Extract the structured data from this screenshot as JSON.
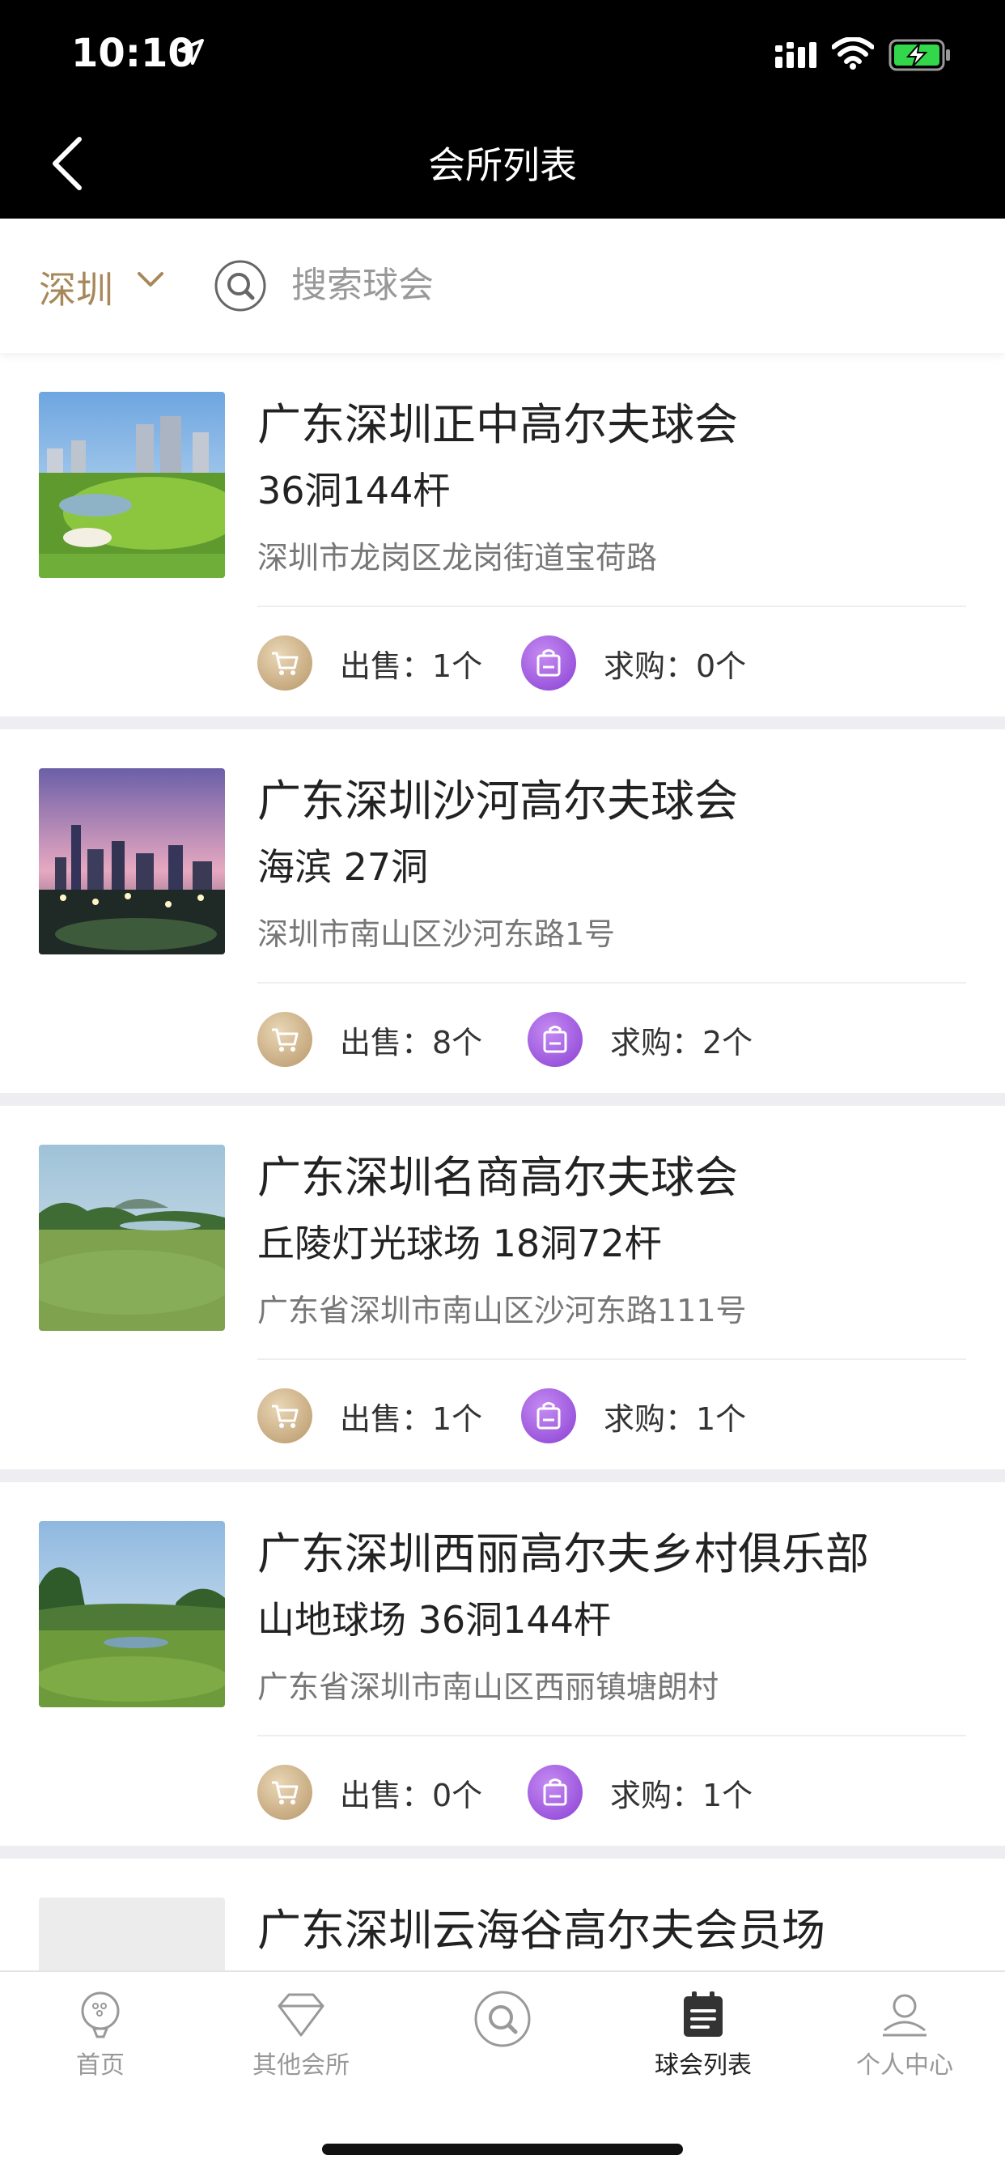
{
  "status": {
    "time": "10:10"
  },
  "nav": {
    "title": "会所列表"
  },
  "filter": {
    "city": "深圳",
    "search_placeholder": "搜索球会"
  },
  "clubs": [
    {
      "name": "广东深圳正中高尔夫球会",
      "sub": "36洞144杆",
      "address": "深圳市龙岗区龙岗街道宝荷路",
      "sell": "出售：1个",
      "buy": "求购：0个"
    },
    {
      "name": "广东深圳沙河高尔夫球会",
      "sub": "海滨 27洞",
      "address": "深圳市南山区沙河东路1号",
      "sell": "出售：8个",
      "buy": "求购：2个"
    },
    {
      "name": "广东深圳名商高尔夫球会",
      "sub": "丘陵灯光球场 18洞72杆",
      "address": "广东省深圳市南山区沙河东路111号",
      "sell": "出售：1个",
      "buy": "求购：1个"
    },
    {
      "name": "广东深圳西丽高尔夫乡村俱乐部",
      "sub": "山地球场 36洞144杆",
      "address": "广东省深圳市南山区西丽镇塘朗村",
      "sell": "出售：0个",
      "buy": "求购：1个"
    },
    {
      "name": "广东深圳云海谷高尔夫会员场",
      "sub": "",
      "address": "",
      "sell": "",
      "buy": ""
    }
  ],
  "tabs": [
    {
      "label": "首页",
      "icon": "golf-ball-icon"
    },
    {
      "label": "其他会所",
      "icon": "diamond-icon"
    },
    {
      "label": "",
      "icon": "search-icon"
    },
    {
      "label": "球会列表",
      "icon": "list-board-icon"
    },
    {
      "label": "个人中心",
      "icon": "user-icon"
    }
  ],
  "colors": {
    "accent": "#a8885a",
    "buy": "#8a3fd4",
    "header": "#000000"
  }
}
